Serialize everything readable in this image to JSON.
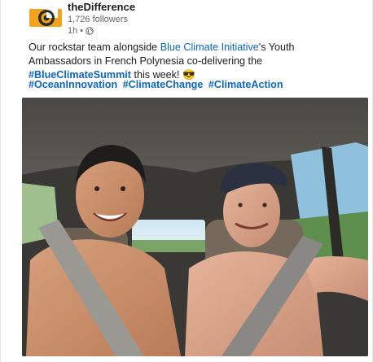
{
  "post": {
    "author": "theDifference",
    "followers": "1,726 followers",
    "time": "1h •",
    "text_before_link1": "Our rockstar team alongside ",
    "link1": "Blue Climate Initiative",
    "text_mid": "'s Youth Ambassadors in French Polynesia co-delivering the ",
    "link2": "#BlueClimateSummit",
    "text_after": " this week! 😎",
    "hashtags": [
      "#OceanInnovation",
      "#ClimateChange",
      "#ClimateAction"
    ]
  },
  "colors": {
    "link": "#0a66c2",
    "text": "#1d1d1d",
    "muted": "#666666",
    "logo_orange": "#f2a21b"
  },
  "icons": {
    "logo": "thedifference-logo",
    "visibility": "globe-icon"
  }
}
